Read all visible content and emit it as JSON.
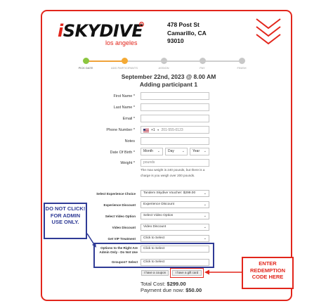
{
  "logo": {
    "brand_prefix": "i",
    "brand_main": "SKYDIVE",
    "reg_mark": "R",
    "location": "los angeles"
  },
  "address": {
    "line1": "478 Post St",
    "line2": "Camarillo, CA",
    "line3": "93010"
  },
  "progress": {
    "steps": [
      {
        "label": "PICK DATE",
        "state": "done"
      },
      {
        "label": "ADD PARTICIPANTS",
        "state": "current"
      },
      {
        "label": "ASSIGN",
        "state": "upcoming"
      },
      {
        "label": "PAY",
        "state": "upcoming"
      },
      {
        "label": "FINISH",
        "state": "upcoming"
      }
    ]
  },
  "booking": {
    "date": "September 22nd, 2023 @ 8.00 AM",
    "status": "Adding participant 1"
  },
  "form": {
    "first_name": {
      "label": "First Name *",
      "value": ""
    },
    "last_name": {
      "label": "Last Name *",
      "value": ""
    },
    "email": {
      "label": "Email *",
      "value": ""
    },
    "phone": {
      "label": "Phone Number *",
      "country_code": "+1",
      "placeholder": "201-555-0123"
    },
    "notes": {
      "label": "Notes",
      "value": ""
    },
    "dob": {
      "label": "Date Of Birth *",
      "month": "Month",
      "day": "Day",
      "year": "Year"
    },
    "weight": {
      "label": "Weight *",
      "placeholder": "pounds",
      "note": "The max weight is 240 pounds, but there is a charge is you weigh over 200 pounds."
    }
  },
  "options": {
    "experience_choice": {
      "label": "Select Experience Choice",
      "value": "Tandem Skydive Voucher: $299.00"
    },
    "experience_discount": {
      "label": "Experience Discount",
      "value": "Experience Discount"
    },
    "video_option": {
      "label": "Select Video Option",
      "value": "Select Video Option"
    },
    "video_discount": {
      "label": "Video Discount",
      "value": "Video Discount"
    },
    "vip_treatment": {
      "label": "Get VIP Treatment",
      "value": "Click to Select"
    },
    "admin_options": {
      "label": "Options to the Right Are Admin Only - Do Not Use",
      "value": "Click to Select"
    },
    "groupon": {
      "label": "Groupon? Select",
      "value": "Click to Select"
    }
  },
  "buttons": {
    "coupon": "I have a coupon",
    "gift_card": "I have a gift card"
  },
  "totals": {
    "total_label": "Total Cost:",
    "total_value": "$299.00",
    "due_label": "Payment due now:",
    "due_value": "$50.00"
  },
  "annotations": {
    "admin_warning": "DO NOT CLICK! FOR ADMIN USE ONLY.",
    "redemption_hint": "ENTER REDEMPTION CODE HERE"
  },
  "colors": {
    "accent_red": "#e2261c",
    "annotation_blue": "#2f3b96",
    "step_done": "#8cc63f",
    "step_current": "#f4a933"
  }
}
